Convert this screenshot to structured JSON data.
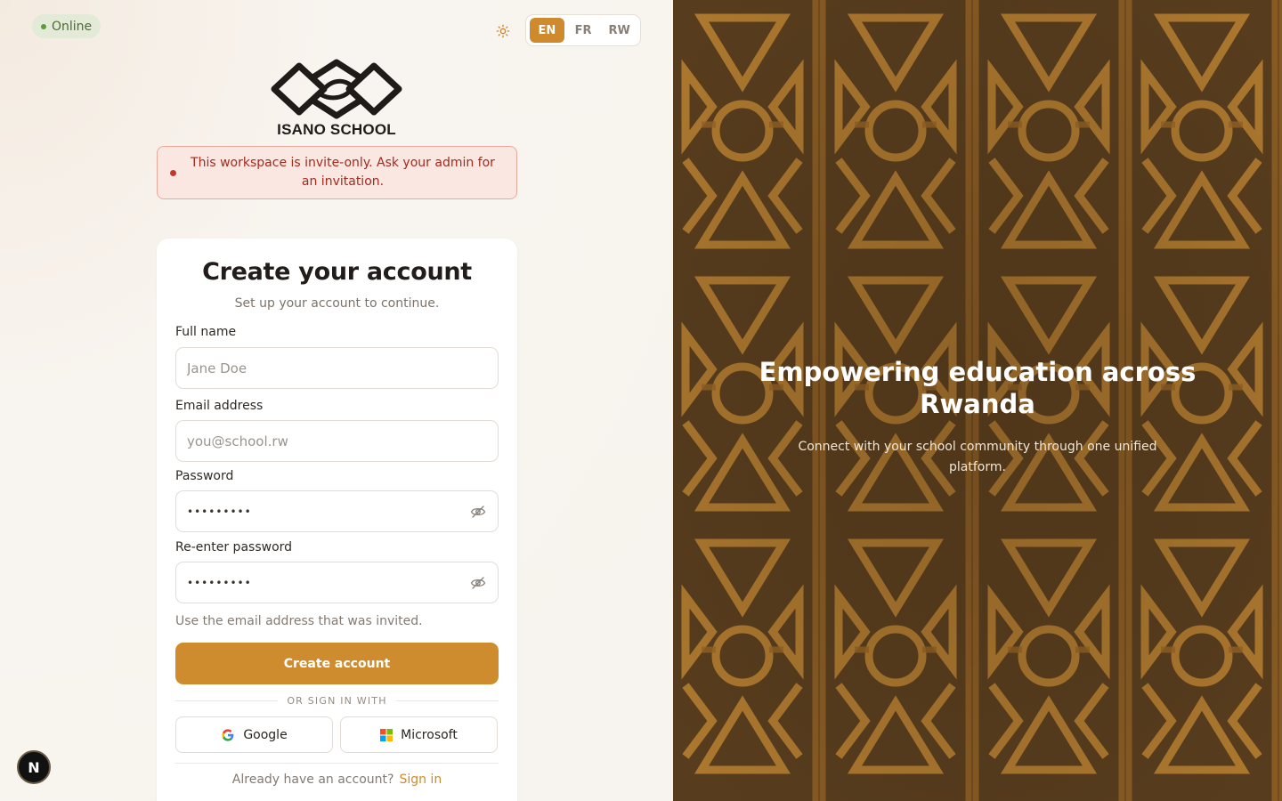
{
  "status": {
    "label": "Online",
    "color": "#5d9a3c"
  },
  "header": {
    "theme_icon": "sun-icon",
    "languages": [
      {
        "code": "EN",
        "active": true
      },
      {
        "code": "FR",
        "active": false
      },
      {
        "code": "RW",
        "active": false
      }
    ]
  },
  "brand": {
    "name": "ISANO SCHOOL"
  },
  "alert": {
    "message": "This workspace is invite-only. Ask your admin for an invitation.",
    "color": "#c0392b"
  },
  "form": {
    "title": "Create your account",
    "subtitle": "Set up your account to continue.",
    "full_name": {
      "label": "Full name",
      "placeholder": "Jane Doe",
      "value": ""
    },
    "email": {
      "label": "Email address",
      "placeholder": "you@school.rw",
      "value": ""
    },
    "password": {
      "label": "Password",
      "masked": "•••••••••"
    },
    "confirm_password": {
      "label": "Re-enter password",
      "masked": "•••••••••"
    },
    "hint": "Use the email address that was invited.",
    "submit_label": "Create account",
    "divider_label": "OR SIGN IN WITH",
    "sso": {
      "google": "Google",
      "microsoft": "Microsoft"
    },
    "footer_prompt": "Already have an account?",
    "footer_link": "Sign in"
  },
  "badge": {
    "letter": "N"
  },
  "hero": {
    "title": "Empowering education across Rwanda",
    "subtitle": "Connect with your school community through one unified platform."
  },
  "colors": {
    "accent": "#cf8a2e",
    "hero_bg": "#5a3f1e",
    "pattern": "#c88a35"
  }
}
